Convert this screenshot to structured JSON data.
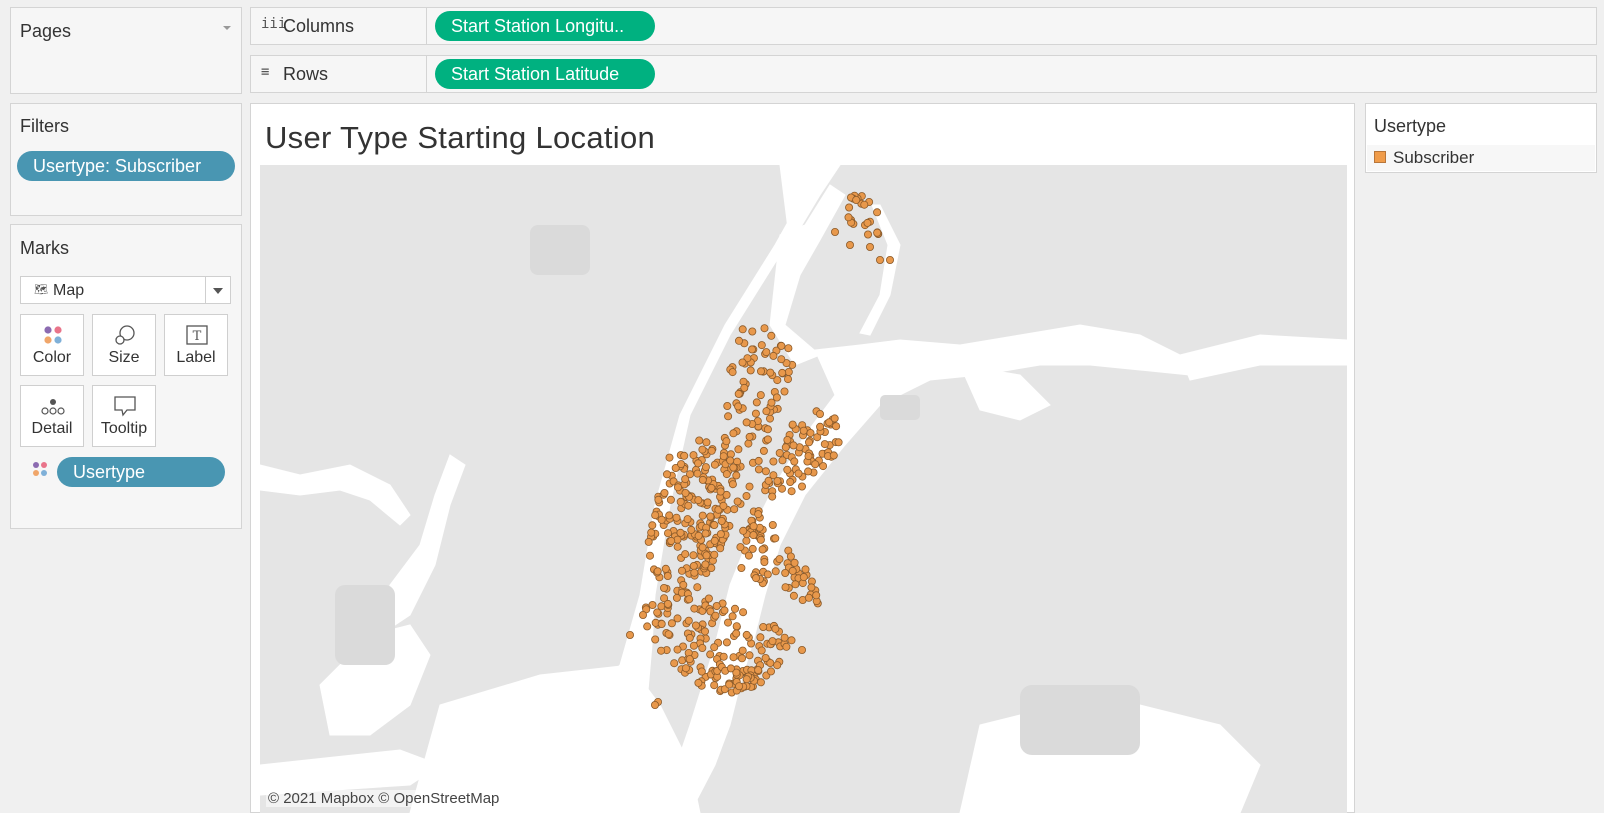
{
  "pages": {
    "title": "Pages"
  },
  "columns": {
    "label": "Columns",
    "icon": "columns-icon",
    "pill": "Start Station Longitu.."
  },
  "rows": {
    "label": "Rows",
    "icon": "rows-icon",
    "pill": "Start Station Latitude"
  },
  "filters": {
    "title": "Filters",
    "pill": "Usertype: Subscriber"
  },
  "marks": {
    "title": "Marks",
    "mark_type": "Map",
    "cards": [
      {
        "label": "Color",
        "icon": "color-icon"
      },
      {
        "label": "Size",
        "icon": "size-icon"
      },
      {
        "label": "Label",
        "icon": "label-icon"
      },
      {
        "label": "Detail",
        "icon": "detail-icon"
      },
      {
        "label": "Tooltip",
        "icon": "tooltip-icon"
      }
    ],
    "field_pill": "Usertype"
  },
  "view": {
    "title": "User Type Starting Location",
    "attribution": "© 2021 Mapbox © OpenStreetMap"
  },
  "legend": {
    "title": "Usertype",
    "items": [
      {
        "label": "Subscriber",
        "color": "#f09c4a"
      }
    ]
  },
  "colors": {
    "mark_fill": "#e8984b",
    "mark_stroke": "#8a5a2a",
    "water": "#ffffff",
    "land": "#e5e5e5",
    "pill_green": "#00b180",
    "pill_blue": "#4996b2"
  }
}
